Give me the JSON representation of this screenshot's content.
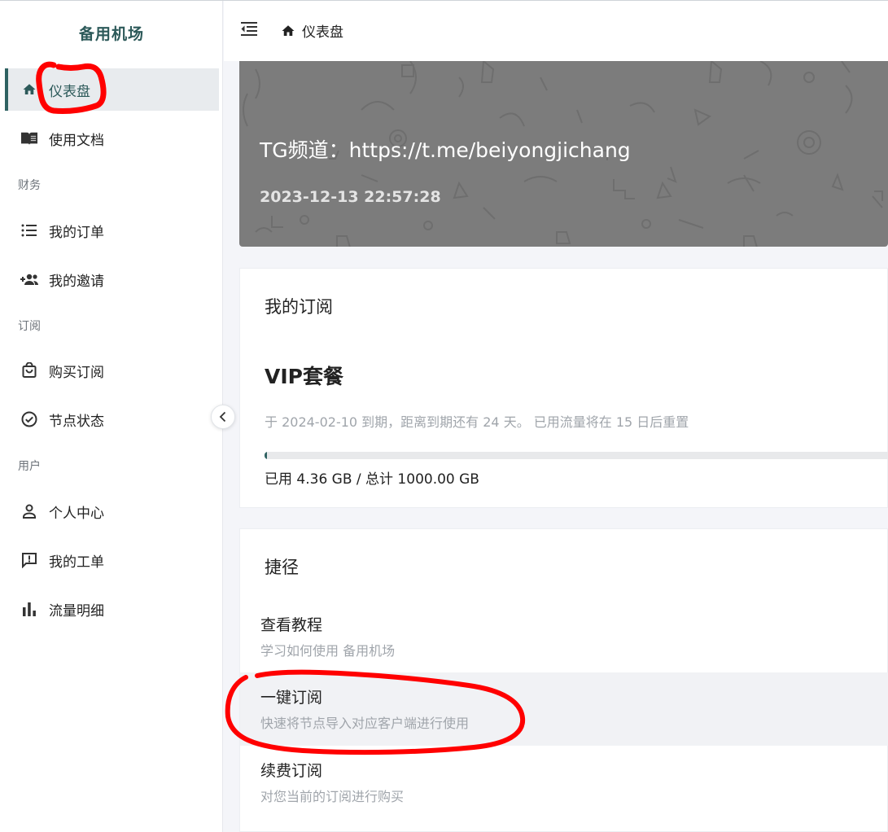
{
  "brand": {
    "name": "备用机场"
  },
  "sidebar": {
    "items": [
      {
        "label": "仪表盘",
        "icon": "home-icon",
        "active": true
      },
      {
        "label": "使用文档",
        "icon": "book-icon"
      },
      {
        "label": "我的订单",
        "icon": "list-icon"
      },
      {
        "label": "我的邀请",
        "icon": "invite-group-icon"
      },
      {
        "label": "购买订阅",
        "icon": "shopping-bag-icon"
      },
      {
        "label": "节点状态",
        "icon": "check-circle-icon"
      },
      {
        "label": "个人中心",
        "icon": "person-icon"
      },
      {
        "label": "我的工单",
        "icon": "ticket-alert-icon"
      },
      {
        "label": "流量明细",
        "icon": "bar-chart-icon"
      }
    ],
    "sections": {
      "finance": "财务",
      "subscription": "订阅",
      "user": "用户"
    }
  },
  "header": {
    "breadcrumb": "仪表盘"
  },
  "banner": {
    "title": "TG频道：https://t.me/beiyongjichang",
    "time": "2023-12-13 22:57:28"
  },
  "subscription": {
    "card_title": "我的订阅",
    "plan_name": "VIP套餐",
    "expire_text": "于 2024-02-10 到期，距离到期还有 24 天。 已用流量将在 15 日后重置",
    "usage_text": "已用 4.36 GB / 总计 1000.00 GB",
    "usage_fraction": 0.00436
  },
  "shortcuts": {
    "card_title": "捷径",
    "items": [
      {
        "title": "查看教程",
        "desc": "学习如何使用 备用机场"
      },
      {
        "title": "一键订阅",
        "desc": "快速将节点导入对应客户端进行使用"
      },
      {
        "title": "续费订阅",
        "desc": "对您当前的订阅进行购买"
      }
    ]
  },
  "colors": {
    "accent": "#2f6262",
    "annotation": "#ff0000",
    "banner": "#7c7c7c"
  }
}
